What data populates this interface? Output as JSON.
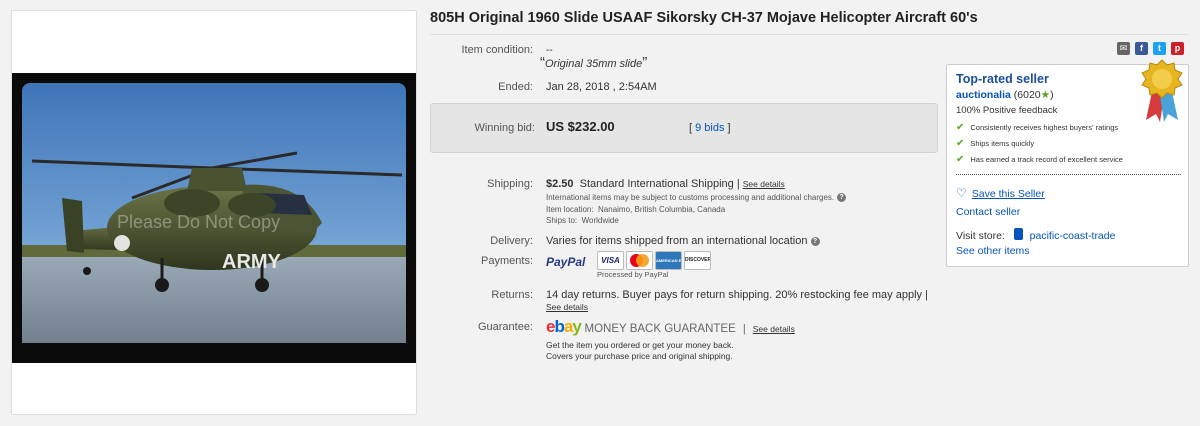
{
  "listing": {
    "title": "805H Original 1960 Slide USAAF Sikorsky CH-37 Mojave Helicopter Aircraft 60's",
    "watermark": "Please Do Not Copy",
    "photo_text": "ARMY"
  },
  "condition": {
    "label": "Item condition:",
    "value": "--",
    "quote": "Original 35mm slide",
    "open_quote": "“",
    "close_quote": "”"
  },
  "ended": {
    "label": "Ended:",
    "value": "Jan 28, 2018 , 2:54AM"
  },
  "bid": {
    "label": "Winning bid:",
    "amount": "US $232.00",
    "bids_link": "9 bids",
    "open_bracket": "[",
    "close_bracket": "]"
  },
  "shipping": {
    "label": "Shipping:",
    "cost": "$2.50",
    "method": "Standard International Shipping |",
    "details_link": "See details",
    "note": "International items may be subject to customs processing and additional charges.",
    "location_label": "Item location:",
    "location": "Nanaimo, British Columbia, Canada",
    "ships_label": "Ships to:",
    "ships_to": "Worldwide"
  },
  "delivery": {
    "label": "Delivery:",
    "value": "Varies for items shipped from an international location"
  },
  "payments": {
    "label": "Payments:",
    "paypal": "PayPal",
    "processed": "Processed by PayPal",
    "cards": [
      "VISA",
      "MasterCard",
      "AMERICAN EXPRESS",
      "DISCOVER"
    ]
  },
  "returns": {
    "label": "Returns:",
    "value": "14 day returns. Buyer pays for return shipping. 20% restocking fee may apply |",
    "details_link": "See details"
  },
  "guarantee": {
    "label": "Guarantee:",
    "ebay": "ebay",
    "mbg": "MONEY BACK GUARANTEE",
    "sep": "|",
    "details_link": "See details",
    "line1": "Get the item you ordered or get your money back.",
    "line2": "Covers your purchase price and original shipping."
  },
  "seller": {
    "heading": "Top-rated seller",
    "name": "auctionalia",
    "score": "(6020",
    "score_end": ")",
    "feedback": "100% Positive feedback",
    "bullets": [
      "Consistently receives highest buyers' ratings",
      "Ships items quickly",
      "Has earned a track record of excellent service"
    ],
    "save": "Save this Seller",
    "contact": "Contact seller",
    "visit_label": "Visit store:",
    "store": "pacific-coast-trade",
    "other": "See other items"
  },
  "share": {
    "email_icon": "email-icon",
    "facebook_icon": "facebook-icon",
    "twitter_icon": "twitter-icon",
    "pinterest_icon": "pinterest-icon"
  },
  "colors": {
    "link": "#0654ba",
    "heading": "#1a4f9a",
    "check": "#5ba21c",
    "facebook": "#3b5998",
    "twitter": "#1da1f2",
    "pinterest": "#cb2027",
    "email": "#666666"
  }
}
